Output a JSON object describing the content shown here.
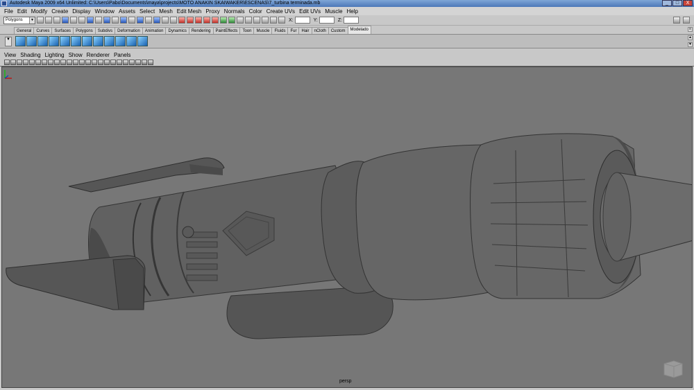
{
  "window": {
    "title": "Autodesk Maya 2009 x64 Unlimited: C:\\Users\\Pabo\\Documents\\maya\\projects\\MOTO ANAKIN SKAIWAKER\\ESCENAS\\7_turbina terminada.mb",
    "minimize": "_",
    "maximize": "□",
    "close": "X"
  },
  "menu": [
    "File",
    "Edit",
    "Modify",
    "Create",
    "Display",
    "Window",
    "Assets",
    "Select",
    "Mesh",
    "Edit Mesh",
    "Proxy",
    "Normals",
    "Color",
    "Create UVs",
    "Edit UVs",
    "Muscle",
    "Help"
  ],
  "status_line": {
    "mode": "Polygons",
    "x_label": "X:",
    "y_label": "Y:",
    "z_label": "Z:"
  },
  "shelf": {
    "tabs": [
      "General",
      "Curves",
      "Surfaces",
      "Polygons",
      "Subdivs",
      "Deformation",
      "Animation",
      "Dynamics",
      "Rendering",
      "PaintEffects",
      "Toon",
      "Muscle",
      "Fluids",
      "Fur",
      "Hair",
      "nCloth",
      "Custom",
      "Modelado"
    ],
    "active_tab": "Modelado"
  },
  "panel_menu": [
    "View",
    "Shading",
    "Lighting",
    "Show",
    "Renderer",
    "Panels"
  ],
  "viewport": {
    "camera": "persp",
    "background": "#777777",
    "model_color": "#5e5e5e"
  }
}
